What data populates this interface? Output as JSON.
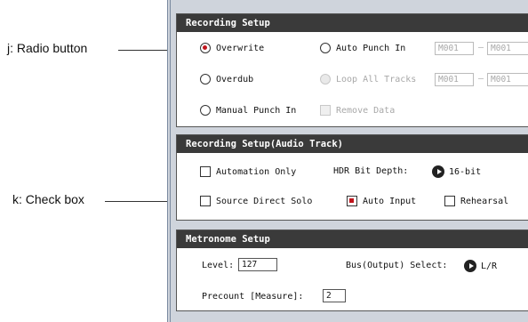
{
  "callouts": {
    "radio_button": "j: Radio button",
    "check_box": "k: Check box"
  },
  "recording_setup": {
    "title": "Recording Setup",
    "overwrite": "Overwrite",
    "overdub": "Overdub",
    "manual_punch_in": "Manual Punch In",
    "auto_punch_in": "Auto Punch In",
    "loop_all_tracks": "Loop All Tracks",
    "remove_data": "Remove Data",
    "punch_from_1": "M001",
    "punch_to_1": "M001",
    "punch_from_2": "M001",
    "punch_to_2": "M001",
    "dash": "–"
  },
  "audio_track": {
    "title": "Recording Setup(Audio Track)",
    "automation_only": "Automation Only",
    "hdr_bit_depth_label": "HDR Bit Depth:",
    "hdr_bit_depth_value": "16-bit",
    "source_direct_solo": "Source Direct Solo",
    "auto_input": "Auto Input",
    "rehearsal": "Rehearsal"
  },
  "metronome": {
    "title": "Metronome Setup",
    "level_label": "Level:",
    "level_value": "127",
    "bus_label": "Bus(Output) Select:",
    "bus_value": "L/R",
    "precount_label": "Precount [Measure]:",
    "precount_value": "2"
  },
  "colors": {
    "selected": "#c0141c",
    "header": "#3a3a3a",
    "frame": "#cfd4dc"
  }
}
